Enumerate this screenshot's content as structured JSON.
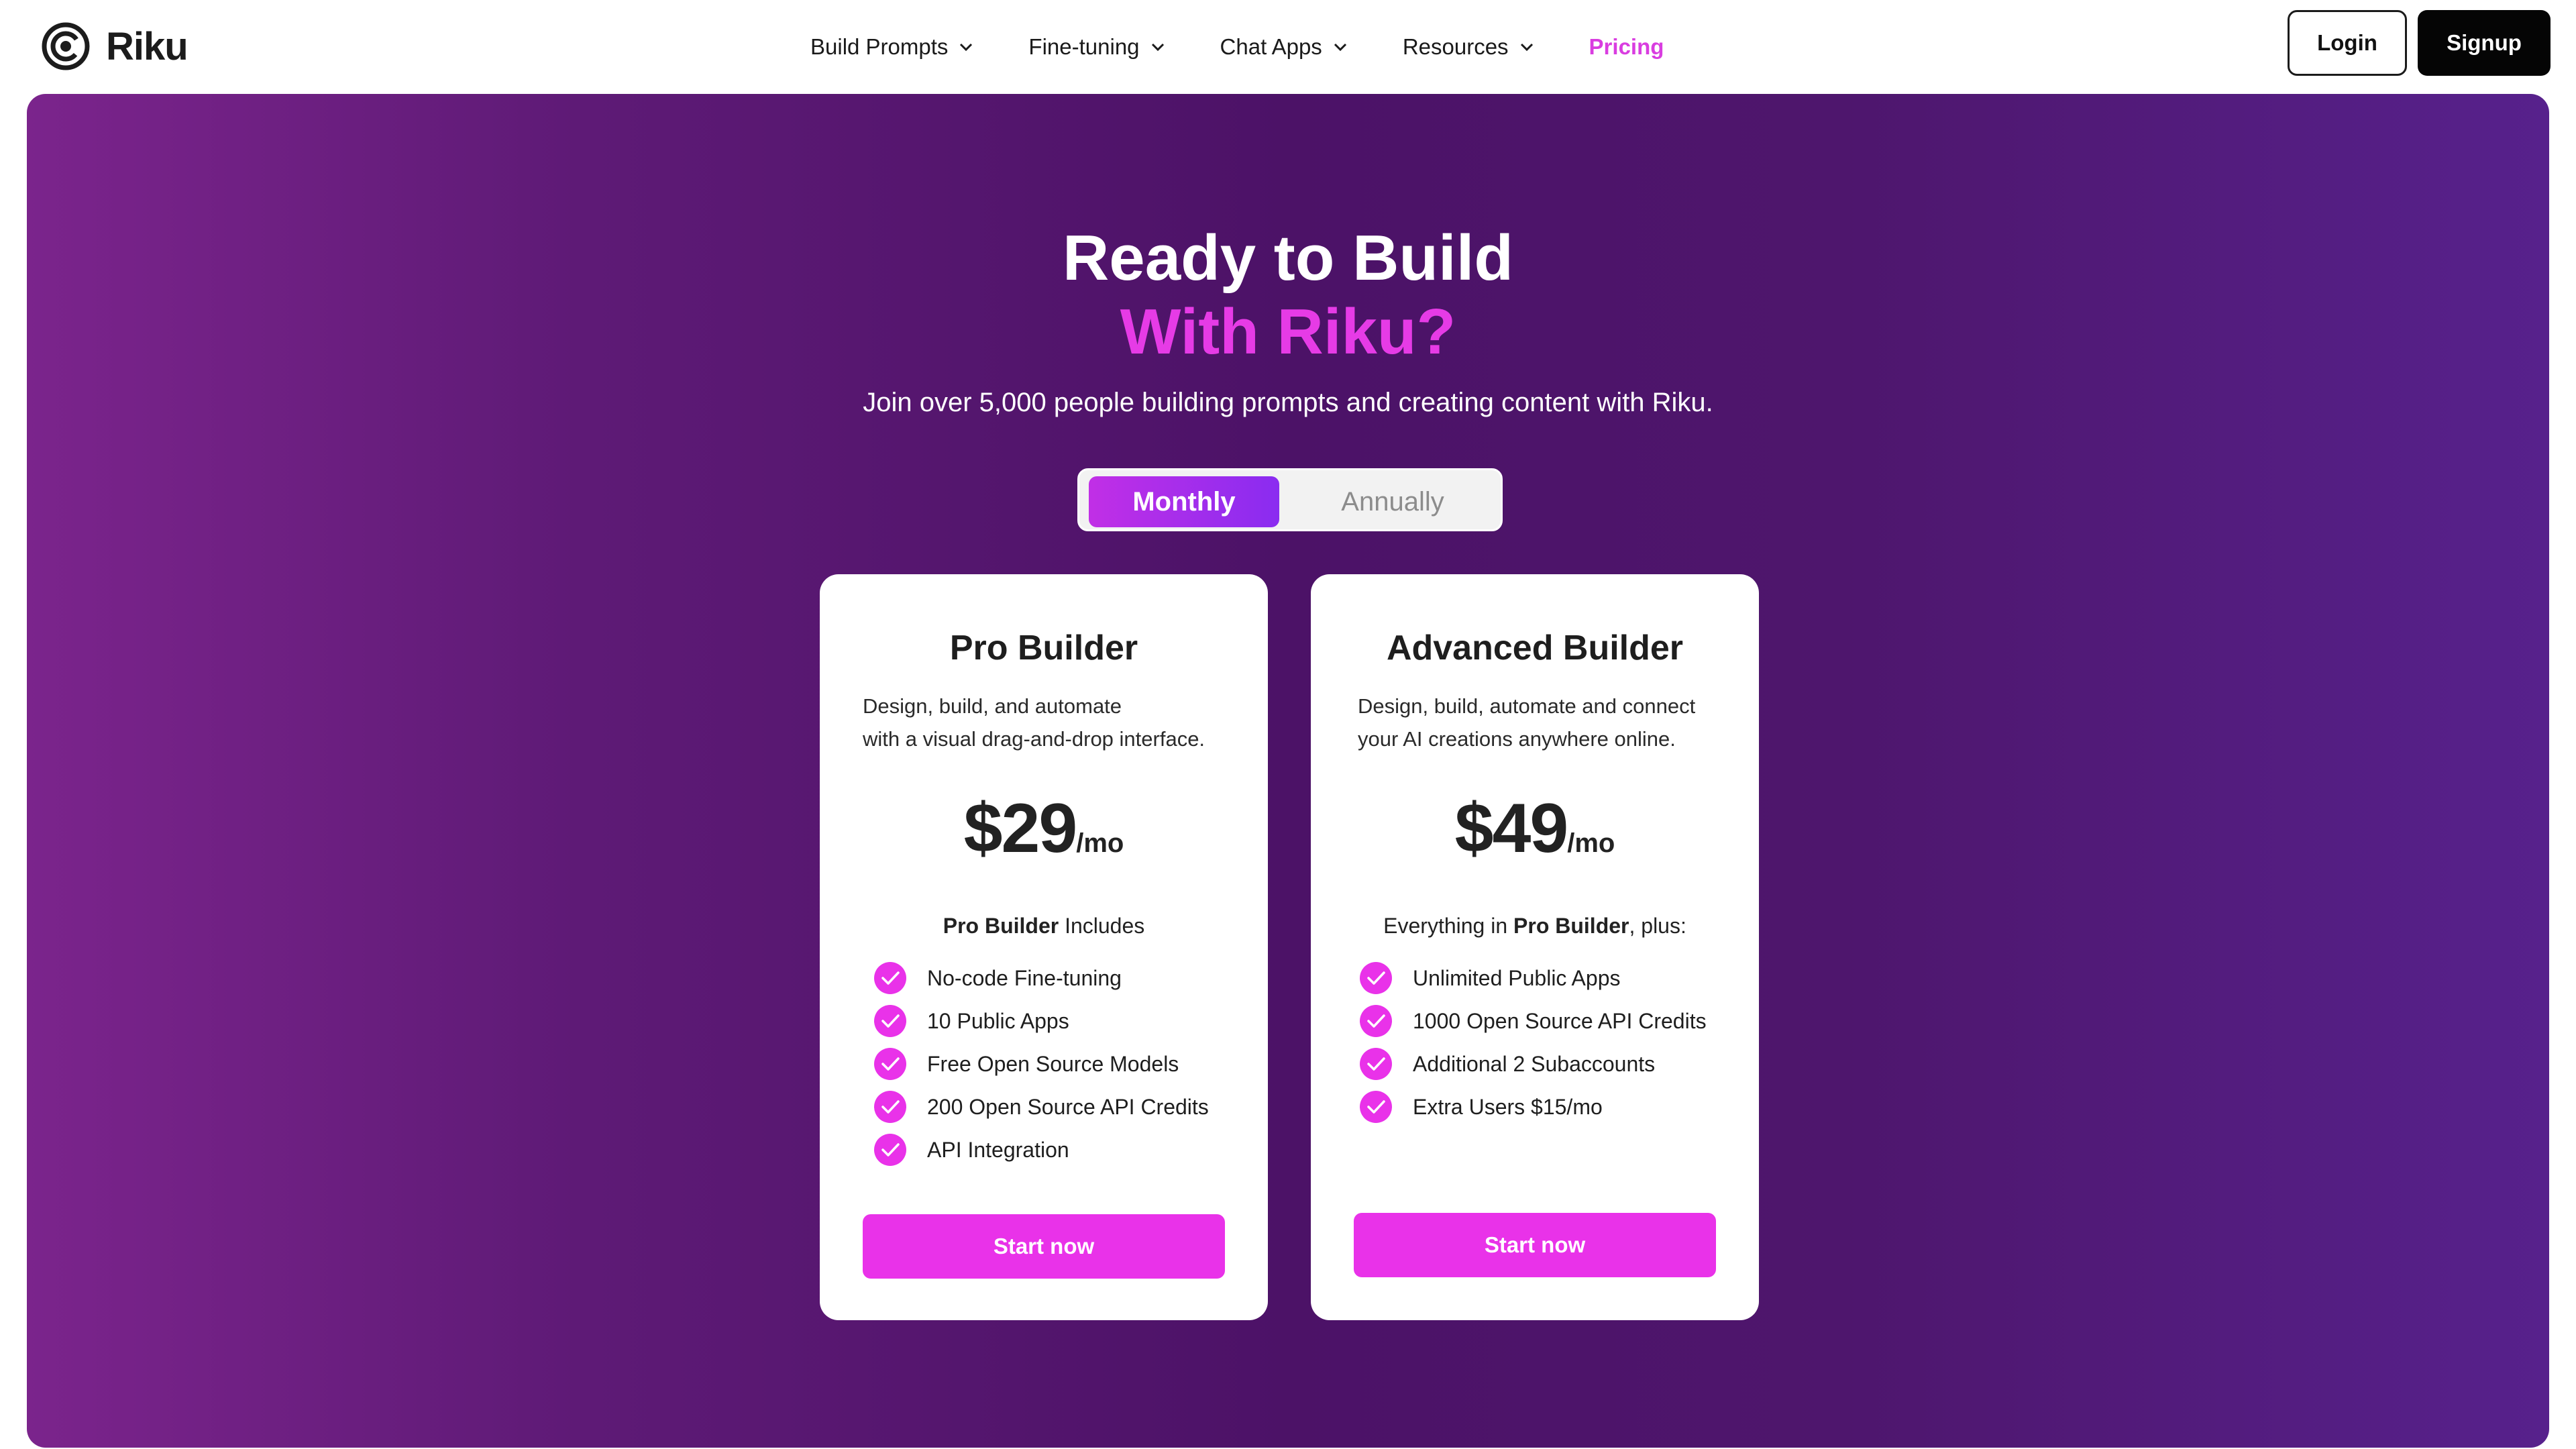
{
  "brand": {
    "name": "Riku"
  },
  "nav": {
    "items": [
      {
        "label": "Build Prompts",
        "dropdown": true
      },
      {
        "label": "Fine-tuning",
        "dropdown": true
      },
      {
        "label": "Chat Apps",
        "dropdown": true
      },
      {
        "label": "Resources",
        "dropdown": true
      },
      {
        "label": "Pricing",
        "dropdown": false,
        "active": true
      }
    ],
    "login_label": "Login",
    "signup_label": "Signup"
  },
  "hero": {
    "title_line1": "Ready to Build",
    "title_line2": "With Riku?",
    "subtitle": "Join over 5,000 people building prompts and creating content with Riku."
  },
  "billing_toggle": {
    "monthly_label": "Monthly",
    "annually_label": "Annually",
    "selected": "Monthly"
  },
  "plans": [
    {
      "name": "Pro Builder",
      "desc_line1": "Design, build, and automate",
      "desc_line2": "with a visual drag-and-drop interface.",
      "price": "$29",
      "per": "/mo",
      "includes_bold": "Pro Builder",
      "includes_prefix": "",
      "includes_suffix": " Includes",
      "features": [
        "No-code Fine-tuning",
        "10 Public Apps",
        "Free Open Source Models",
        "200 Open Source API Credits",
        "API Integration"
      ],
      "cta": "Start now"
    },
    {
      "name": "Advanced Builder",
      "desc_line1": "Design, build, automate and connect",
      "desc_line2": "your AI creations anywhere online.",
      "price": "$49",
      "per": "/mo",
      "includes_prefix": "Everything in ",
      "includes_bold": "Pro Builder",
      "includes_suffix": ", plus:",
      "features": [
        "Unlimited Public Apps",
        "1000 Open Source API Credits",
        "Additional 2 Subaccounts",
        "Extra Users $15/mo"
      ],
      "cta": "Start now"
    }
  ],
  "colors": {
    "accent": "#e932e9",
    "title_accent": "#e63be6",
    "nav_active": "#d93de0",
    "hero_gradient_start": "#7b248c",
    "hero_gradient_end": "#57218c"
  }
}
